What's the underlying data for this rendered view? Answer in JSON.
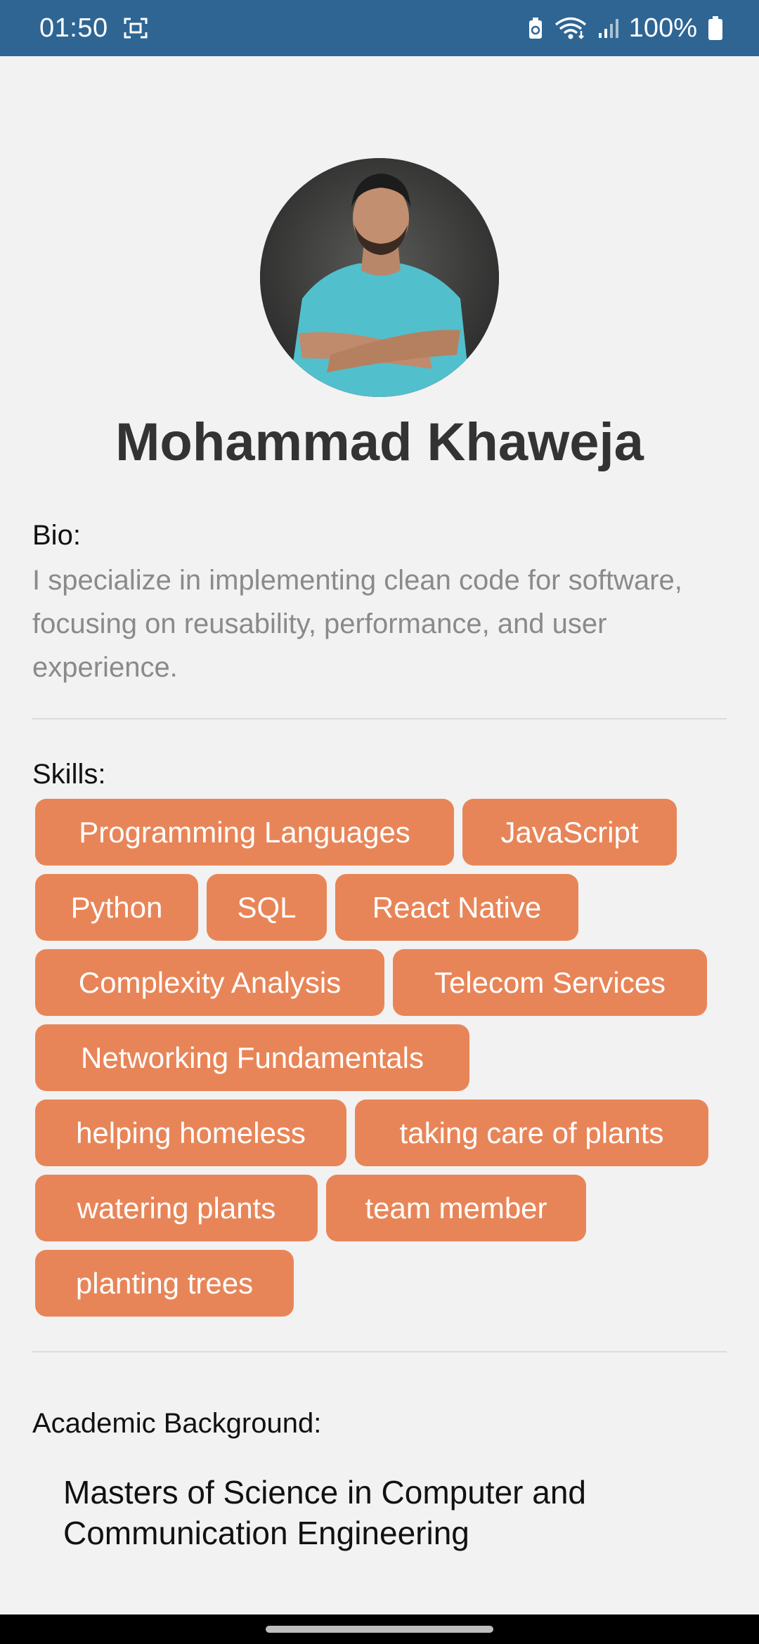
{
  "status_bar": {
    "time": "01:50",
    "battery_percent": "100%",
    "icons": [
      "screenshot-icon",
      "battery-saver-icon",
      "wifi-icon",
      "signal-icon",
      "battery-icon"
    ]
  },
  "profile": {
    "name": "Mohammad Khaweja",
    "avatar": "profile-photo"
  },
  "bio": {
    "label": "Bio:",
    "text": "I specialize in implementing clean code for software, focusing on reusability, performance, and user experience."
  },
  "skills": {
    "label": "Skills:",
    "chip_color": "#e88558",
    "items": [
      "Programming Languages",
      "JavaScript",
      "Python",
      "SQL",
      "React Native",
      "Complexity Analysis",
      "Telecom Services",
      "Networking Fundamentals",
      "helping homeless",
      "taking care of plants",
      "watering plants",
      "team member",
      "planting trees"
    ]
  },
  "academic": {
    "label": "Academic Background:",
    "text": "Masters of Science in Computer and Communication Engineering"
  },
  "colors": {
    "status_bar": "#2e6593",
    "background": "#f2f2f2"
  }
}
